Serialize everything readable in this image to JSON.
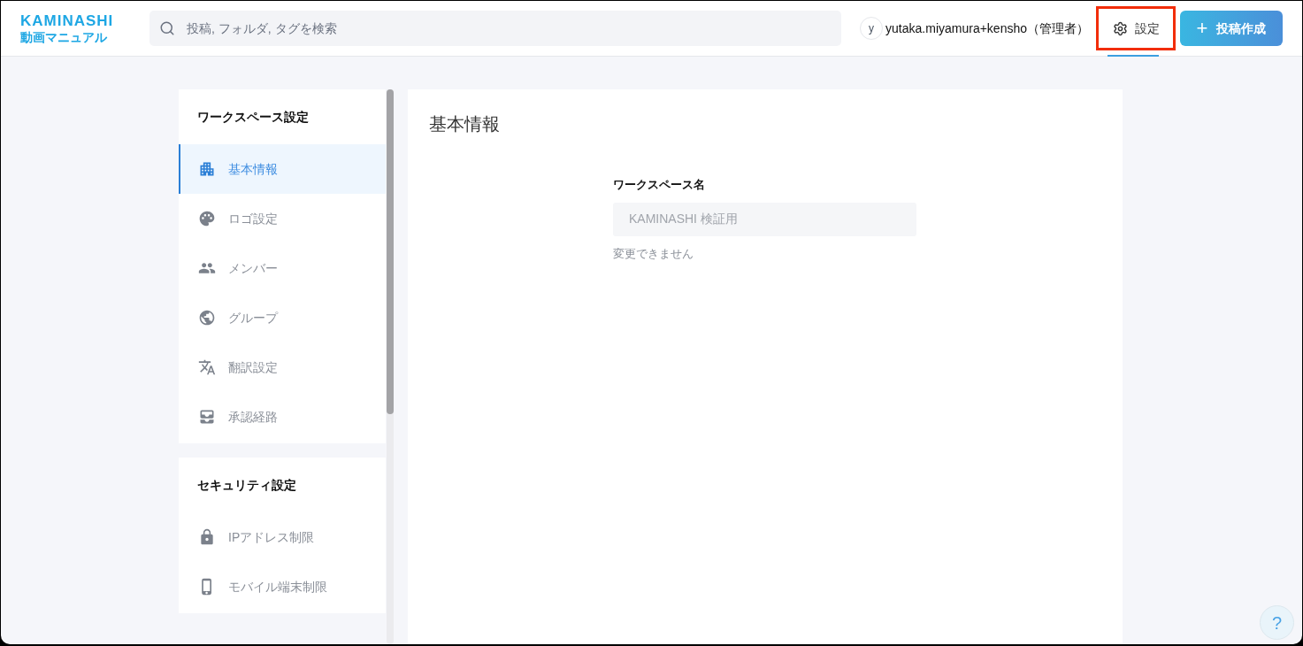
{
  "header": {
    "logo": {
      "brand": "KAMINASHI",
      "product": "動画マニュアル"
    },
    "search": {
      "placeholder": "投稿, フォルダ, タグを検索"
    },
    "user": {
      "initial": "y",
      "name": "yutaka.miyamura+kensho（管理者）"
    },
    "settings": {
      "label": "設定",
      "selected": true,
      "highlighted": true
    },
    "post_button": {
      "icon": "+",
      "label": "投稿作成"
    }
  },
  "sidebar": [
    {
      "title": "ワークスペース設定",
      "items": [
        {
          "label": "基本情報",
          "selected": true
        },
        {
          "label": "ロゴ設定",
          "selected": false
        },
        {
          "label": "メンバー",
          "selected": false
        },
        {
          "label": "グループ",
          "selected": false
        },
        {
          "label": "翻訳設定",
          "selected": false
        },
        {
          "label": "承認経路",
          "selected": false
        }
      ]
    },
    {
      "title": "セキュリティ設定",
      "items": [
        {
          "label": "IPアドレス制限",
          "selected": false
        },
        {
          "label": "モバイル端末制限",
          "selected": false
        }
      ]
    }
  ],
  "main": {
    "title": "基本情報",
    "field": {
      "label": "ワークスペース名",
      "value": "KAMINASHI 検証用",
      "disabled": true,
      "note": "変更できません"
    }
  },
  "help_button": {
    "label": "?"
  }
}
